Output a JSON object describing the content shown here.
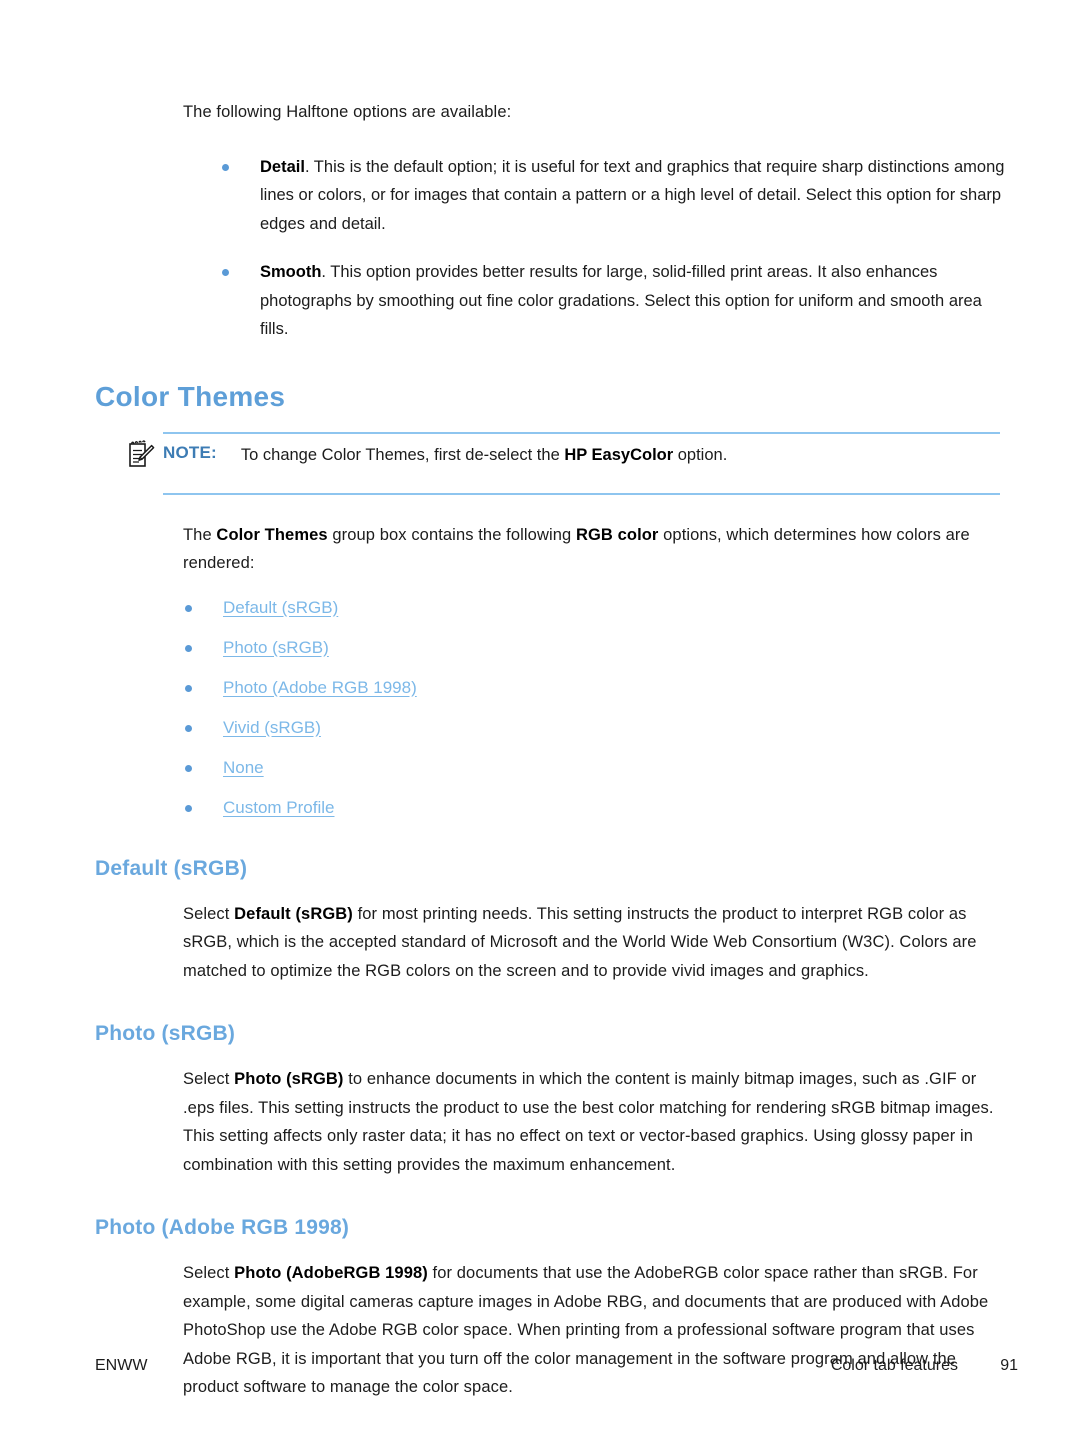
{
  "document": {
    "intro": "The following Halftone options are available:",
    "halftone_options": [
      {
        "term": "Detail",
        "rest": ". This is the default option; it is useful for text and graphics that require sharp distinctions among lines or colors, or for images that contain a pattern or a high level of detail. Select this option for sharp edges and detail."
      },
      {
        "term": "Smooth",
        "rest": ". This option provides better results for large, solid-filled print areas. It also enhances photographs by smoothing out fine color gradations. Select this option for uniform and smooth area fills."
      }
    ],
    "color_themes": {
      "heading": "Color Themes",
      "note": {
        "icon": "note-pad-pencil-icon",
        "label": "NOTE:",
        "text_before": "To change Color Themes, first de-select the ",
        "text_bold": "HP EasyColor",
        "text_after": " option."
      },
      "intro_1": "The ",
      "intro_bold_1": "Color Themes",
      "intro_2": " group box contains the following ",
      "intro_bold_2": "RGB color",
      "intro_3": " options, which determines how colors are rendered:",
      "links": [
        "Default (sRGB)",
        "Photo (sRGB)",
        "Photo (Adobe RGB 1998)",
        "Vivid (sRGB)",
        "None",
        "Custom Profile"
      ]
    },
    "sections": [
      {
        "heading": "Default (sRGB)",
        "lead": "Select ",
        "lead_bold": "Default (sRGB)",
        "body": " for most printing needs. This setting instructs the product to interpret RGB color as sRGB, which is the accepted standard of Microsoft and the World Wide Web Consortium (W3C). Colors are matched to optimize the RGB colors on the screen and to provide vivid images and graphics."
      },
      {
        "heading": "Photo (sRGB)",
        "lead": "Select ",
        "lead_bold": "Photo (sRGB)",
        "body": " to enhance documents in which the content is mainly bitmap images, such as .GIF or .eps files. This setting instructs the product to use the best color matching for rendering sRGB bitmap images. This setting affects only raster data; it has no effect on text or vector-based graphics. Using glossy paper in combination with this setting provides the maximum enhancement."
      },
      {
        "heading": "Photo (Adobe RGB 1998)",
        "lead": "Select ",
        "lead_bold": "Photo (AdobeRGB 1998)",
        "body": " for documents that use the AdobeRGB color space rather than sRGB. For example, some digital cameras capture images in Adobe RBG, and documents that are produced with Adobe PhotoShop use the Adobe RGB color space. When printing from a professional software program that uses Adobe RGB, it is important that you turn off the color management in the software program and allow the product software to manage the color space."
      }
    ],
    "footer": {
      "left": "ENWW",
      "section": "Color tab features",
      "page": "91"
    },
    "colors": {
      "heading_blue": "#5e9fd8",
      "subheading_blue": "#6aa8de",
      "link_blue": "#7cb8e8",
      "note_label_blue": "#3d7cb4",
      "rule_blue": "#8ec5ef",
      "bullet_blue": "#5a9ad6",
      "body_black": "#1c1c1c"
    }
  }
}
